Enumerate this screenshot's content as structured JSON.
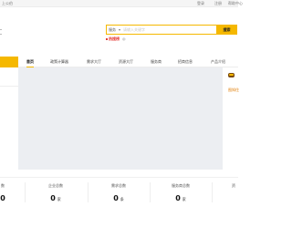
{
  "topbar": {
    "left": "上公伯",
    "right_items": [
      "登录",
      "注册",
      "帮助中心"
    ]
  },
  "search": {
    "category": "服务",
    "placeholder": "请输入关键字",
    "button": "搜索"
  },
  "hot": {
    "label": "热搜榜",
    "items": [
      "◎"
    ]
  },
  "nav": {
    "items": [
      "首页",
      "政策计算器",
      "需求大厅",
      "资源大厅",
      "服务商",
      "招商信息",
      "产品介绍"
    ],
    "active_index": 0
  },
  "right_panel": {
    "text": "图知住"
  },
  "stats": [
    {
      "label": "企业总数",
      "value": "0",
      "unit": "家"
    },
    {
      "label": "需求总数",
      "value": "0",
      "unit": "条"
    },
    {
      "label": "服务商总数",
      "value": "0",
      "unit": "家"
    }
  ],
  "stats_partial": {
    "left_label": "数",
    "left_num": "0",
    "right_label": "资"
  },
  "colors": {
    "accent": "#f5b800",
    "hot": "#e53935",
    "banner": "#eceef2"
  }
}
